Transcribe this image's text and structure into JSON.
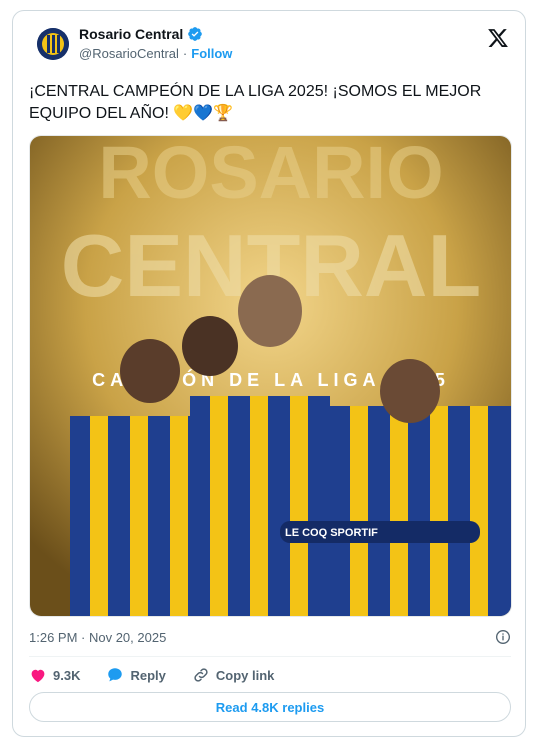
{
  "author": {
    "display_name": "Rosario Central",
    "handle": "@RosarioCentral",
    "separator": "·",
    "follow_label": "Follow"
  },
  "post": {
    "text": "¡CENTRAL CAMPEÓN DE LA LIGA 2025! ¡SOMOS EL MEJOR EQUIPO DEL AÑO! 💛💙🏆",
    "timestamp": "1:26 PM · Nov 20, 2025"
  },
  "media": {
    "headline_top": "ROSARIO",
    "headline_bottom": "CENTRAL",
    "banner": "CAMPEÓN DE LA LIGA 2025",
    "sponsor": "LE COQ SPORTIF"
  },
  "actions": {
    "like_count": "9.3K",
    "reply_label": "Reply",
    "copy_label": "Copy link"
  },
  "read_replies_label": "Read 4.8K replies",
  "colors": {
    "accent": "#1d9bf0",
    "like": "#f91880",
    "gold": "#c9a247",
    "navy": "#16306a"
  }
}
